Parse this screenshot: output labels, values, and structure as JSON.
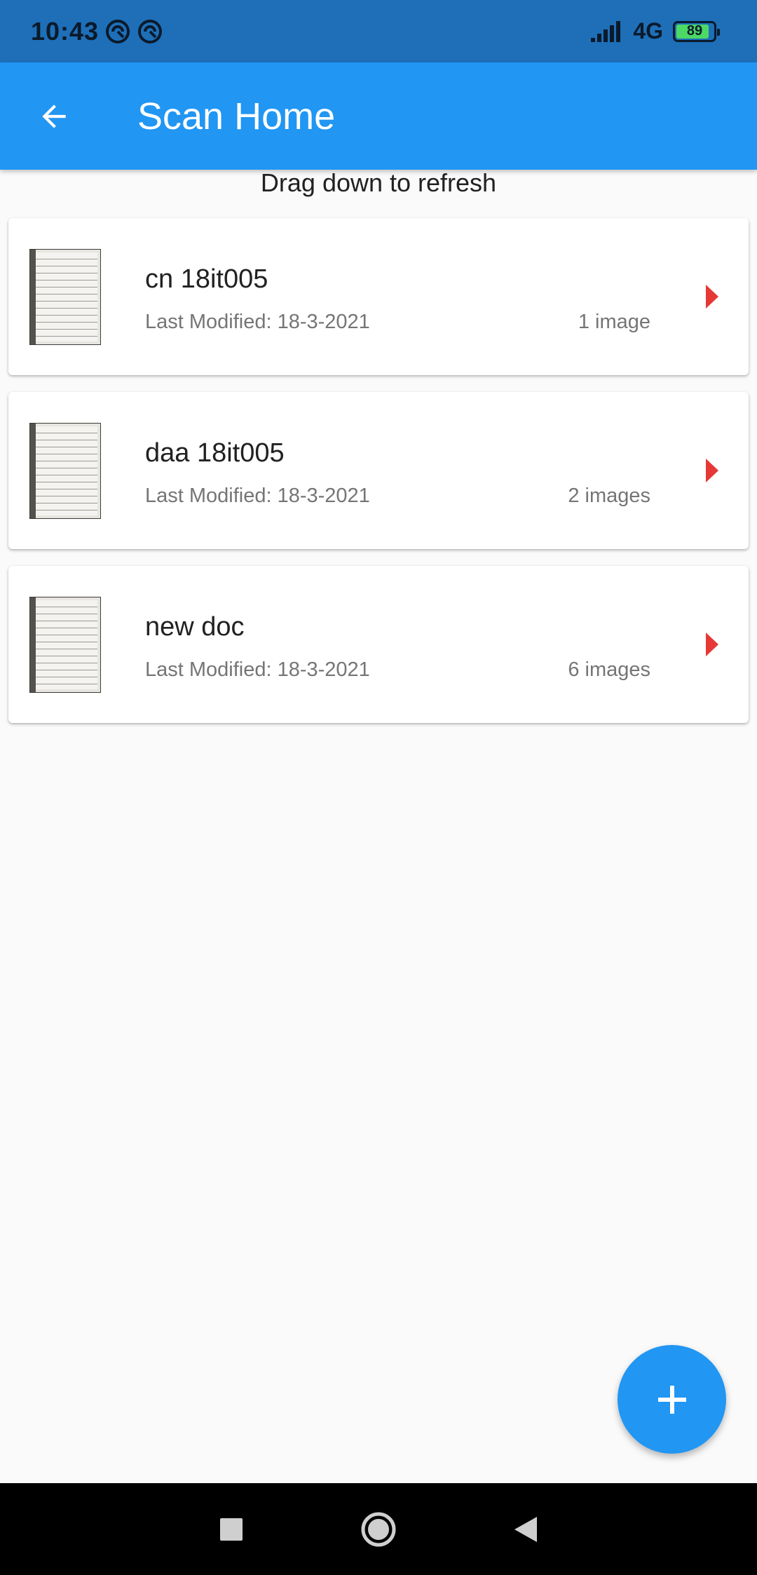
{
  "status_bar": {
    "time": "10:43",
    "network": "4G",
    "battery_level": "89",
    "battery_fraction": 0.89
  },
  "app_bar": {
    "title": "Scan Home"
  },
  "refresh_hint": "Drag down to refresh",
  "documents": [
    {
      "name": "cn 18it005",
      "modified": "Last Modified: 18-3-2021",
      "count": "1 image"
    },
    {
      "name": "daa 18it005",
      "modified": "Last Modified: 18-3-2021",
      "count": "2 images"
    },
    {
      "name": "new doc",
      "modified": "Last Modified: 18-3-2021",
      "count": "6 images"
    }
  ],
  "colors": {
    "status_bar": "#1e6fb8",
    "app_bar": "#2196f3",
    "accent_arrow": "#e53935",
    "fab": "#2196f3"
  },
  "icons": {
    "back": "arrow-left-icon",
    "open_document": "arrow-right-icon",
    "add": "plus-icon",
    "nav_recents": "square-icon",
    "nav_home": "circle-icon",
    "nav_back": "triangle-back-icon"
  }
}
